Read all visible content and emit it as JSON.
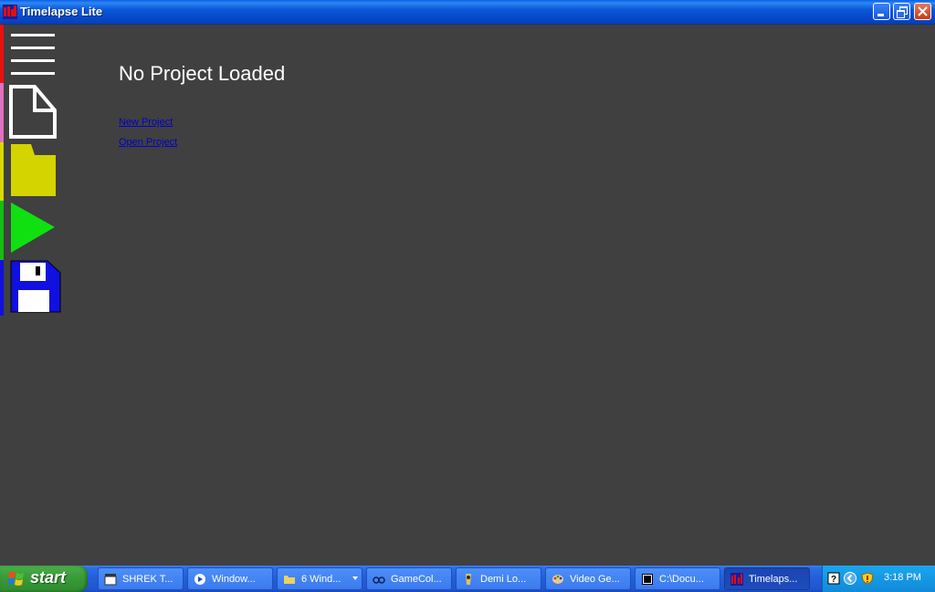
{
  "window": {
    "title": "Timelapse Lite"
  },
  "toolbar": {
    "items": [
      {
        "name": "menu-icon",
        "stripe_color": "#e81010"
      },
      {
        "name": "new-document-icon",
        "stripe_color": "#e070c0"
      },
      {
        "name": "open-folder-icon",
        "stripe_color": "#d8d800"
      },
      {
        "name": "play-icon",
        "stripe_color": "#10c010"
      },
      {
        "name": "save-disk-icon",
        "stripe_color": "#1010e0"
      }
    ]
  },
  "main": {
    "title": "No Project Loaded",
    "new_project_label": "New Project",
    "open_project_label": "Open Project"
  },
  "taskbar": {
    "start_label": "start",
    "tasks": [
      {
        "label": "SHREK T...",
        "icon": "clapper-icon"
      },
      {
        "label": "Window...",
        "icon": "media-player-icon"
      },
      {
        "label": "6 Wind...",
        "icon": "folder-icon"
      },
      {
        "label": "GameCol...",
        "icon": "glasses-icon"
      },
      {
        "label": "Demi Lo...",
        "icon": "app-icon"
      },
      {
        "label": "Video Ge...",
        "icon": "palette-icon"
      },
      {
        "label": "C:\\Docu...",
        "icon": "archive-icon"
      },
      {
        "label": "Timelaps...",
        "icon": "timelapse-icon"
      }
    ],
    "clock": "3:18 PM"
  },
  "colors": {
    "background": "#404040",
    "link": "#0000cc",
    "folder": "#d4d400",
    "play": "#10e010",
    "disk": "#1010e0"
  }
}
